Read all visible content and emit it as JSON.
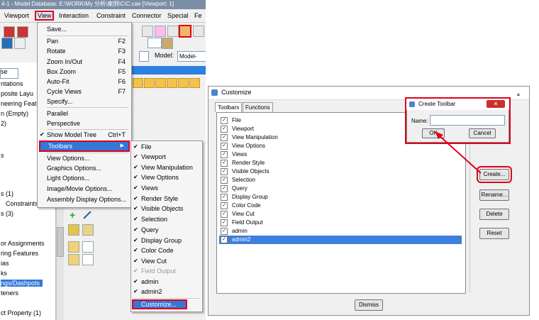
{
  "app": {
    "title": "4-1 - Model Database: E:\\WORK\\My 分析\\案例\\C\\C.cae [Viewport: 1]",
    "menubar": [
      "Viewport",
      "View",
      "Interaction",
      "Constraint",
      "Connector",
      "Special",
      "Fe"
    ],
    "model_label": "Model:",
    "model_value": "Model-"
  },
  "tree": {
    "items": [
      "se",
      "ntations",
      "posite Layu",
      "neering Feat",
      "n (Empty)",
      "2)",
      "s",
      "s (1)",
      "Constraints",
      "s (3)",
      "or Assignments",
      "ring Features",
      "ias",
      "ks",
      "ngs/Dashpots",
      "teners",
      "ct Property (1)"
    ],
    "selected_index": 14
  },
  "view_menu": {
    "items": [
      {
        "label": "Save...",
        "shortcut": ""
      },
      {
        "label": "Pan",
        "shortcut": "F2"
      },
      {
        "label": "Rotate",
        "shortcut": "F3"
      },
      {
        "label": "Zoom In/Out",
        "shortcut": "F4"
      },
      {
        "label": "Box Zoom",
        "shortcut": "F5"
      },
      {
        "label": "Auto-Fit",
        "shortcut": "F6"
      },
      {
        "label": "Cycle Views",
        "shortcut": "F7"
      },
      {
        "label": "Specify...",
        "shortcut": ""
      },
      {
        "label": "Parallel",
        "shortcut": ""
      },
      {
        "label": "Perspective",
        "shortcut": ""
      },
      {
        "label": "Show Model Tree",
        "shortcut": "Ctrl+T"
      },
      {
        "label": "Toolbars",
        "shortcut": ""
      },
      {
        "label": "View Options...",
        "shortcut": ""
      },
      {
        "label": "Graphics Options...",
        "shortcut": ""
      },
      {
        "label": "Light Options...",
        "shortcut": ""
      },
      {
        "label": "Image/Movie Options...",
        "shortcut": ""
      },
      {
        "label": "Assembly Display Options...",
        "shortcut": ""
      }
    ]
  },
  "toolbars_submenu": {
    "items": [
      "File",
      "Viewport",
      "View Manipulation",
      "View Options",
      "Views",
      "Render Style",
      "Visible Objects",
      "Selection",
      "Query",
      "Display Group",
      "Color Code",
      "View Cut",
      "Field Output",
      "admin",
      "admin2"
    ],
    "customize": "Customize..."
  },
  "customize_dialog": {
    "title": "Customize",
    "tabs": [
      "Toolbars",
      "Functions"
    ],
    "toolbars": [
      "File",
      "Viewport",
      "View Manipulation",
      "View Options",
      "Views",
      "Render Style",
      "Visible Objects",
      "Selection",
      "Query",
      "Display Group",
      "Color Code",
      "View Cut",
      "Field Output",
      "admin",
      "admin2"
    ],
    "selected_index": 14,
    "buttons": {
      "create": "Create...",
      "rename": "Rename...",
      "delete": "Delete",
      "reset": "Reset",
      "dismiss": "Dismiss"
    }
  },
  "create_toolbar_dialog": {
    "title": "Create Toolbar",
    "close": "✕",
    "name_label": "Name:",
    "name_value": "",
    "ok": "OK",
    "cancel": "Cancel"
  },
  "colors": {
    "highlight_red": "#e0001a",
    "selection_blue": "#3477d6"
  }
}
